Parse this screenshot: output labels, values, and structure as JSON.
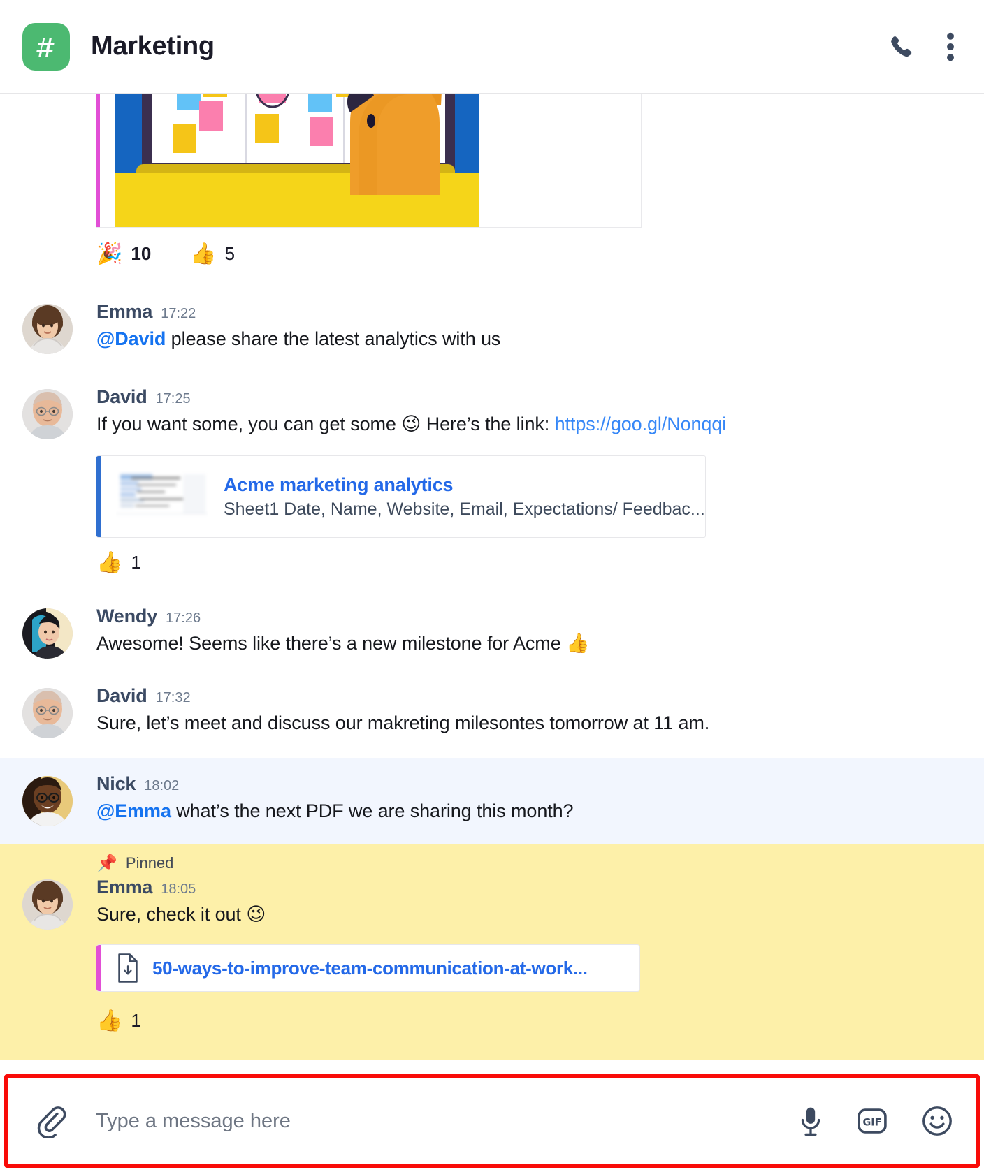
{
  "header": {
    "channel_icon": "hash-icon",
    "channel_name": "Marketing",
    "badge_color": "#4cb971",
    "actions": [
      {
        "name": "call-icon",
        "label": "Call"
      },
      {
        "name": "more-options-icon",
        "label": "More options"
      }
    ]
  },
  "messages": [
    {
      "id": "image-message",
      "attachment_type": "image",
      "attachment_alt": "Illustration of a dog beside a whiteboard covered in sticky notes",
      "reactions": [
        {
          "emoji": "🎉",
          "name": "party-popper-reaction",
          "count": "10",
          "strong": true
        },
        {
          "emoji": "👍",
          "name": "thumbs-up-reaction",
          "count": "5",
          "strong": false
        }
      ]
    },
    {
      "id": "emma-analytics-request",
      "author": "Emma",
      "time": "17:22",
      "avatar": "emma-avatar",
      "mention": "@David",
      "text": " please share the latest analytics with us"
    },
    {
      "id": "david-link-share",
      "author": "David",
      "time": "17:25",
      "avatar": "david-avatar",
      "text_before": "If you want some, you can get some ",
      "emoji": "😉",
      "text_after": " Here’s the link: ",
      "link": "https://goo.gl/Nonqqi",
      "preview": {
        "title": "Acme marketing analytics",
        "description": "Sheet1 Date, Name, Website, Email, Expectations/ Feedbac...",
        "accent": "#2f6fd0",
        "thumb": "spreadsheet-thumbnail"
      },
      "reactions": [
        {
          "emoji": "👍",
          "name": "thumbs-up-reaction",
          "count": "1",
          "strong": false
        }
      ]
    },
    {
      "id": "wendy-milestone",
      "author": "Wendy",
      "time": "17:26",
      "avatar": "wendy-avatar",
      "text": "Awesome! Seems like there’s a new milestone for Acme ",
      "emoji": "👍"
    },
    {
      "id": "david-meeting",
      "author": "David",
      "time": "17:32",
      "avatar": "david-avatar",
      "text": "Sure, let’s meet and discuss our makreting milesontes tomorrow at 11 am."
    },
    {
      "id": "nick-pdf-question",
      "author": "Nick",
      "time": "18:02",
      "avatar": "nick-avatar",
      "highlighted": true,
      "mention": "@Emma",
      "text": " what’s the next PDF we are sharing this month?"
    },
    {
      "id": "emma-pinned-pdf",
      "author": "Emma",
      "time": "18:05",
      "avatar": "emma-avatar",
      "pinned": true,
      "pin_label": "Pinned",
      "pin_emoji": "📌",
      "text": "Sure, check it out ",
      "emoji": "😉",
      "file": {
        "name": "50-ways-to-improve-team-communication-at-work...",
        "icon": "file-download-icon",
        "accent": "#e24fd6"
      },
      "reactions": [
        {
          "emoji": "👍",
          "name": "thumbs-up-reaction",
          "count": "1",
          "strong": false
        }
      ]
    }
  ],
  "composer": {
    "attach_icon": "paperclip-icon",
    "placeholder": "Type a message here",
    "value": "",
    "highlight_color": "#f90b08",
    "actions": [
      {
        "name": "microphone-icon",
        "label": "Voice message"
      },
      {
        "name": "gif-icon",
        "label": "GIF"
      },
      {
        "name": "emoji-icon",
        "label": "Emoji"
      }
    ]
  },
  "colors": {
    "brand_green": "#4cb971",
    "link_blue": "#2469e8",
    "mention_blue": "#1573f0",
    "pinned_yellow": "#fdf0a9",
    "highlight_blue": "#f2f6fe",
    "composer_outline": "#f90b08"
  }
}
